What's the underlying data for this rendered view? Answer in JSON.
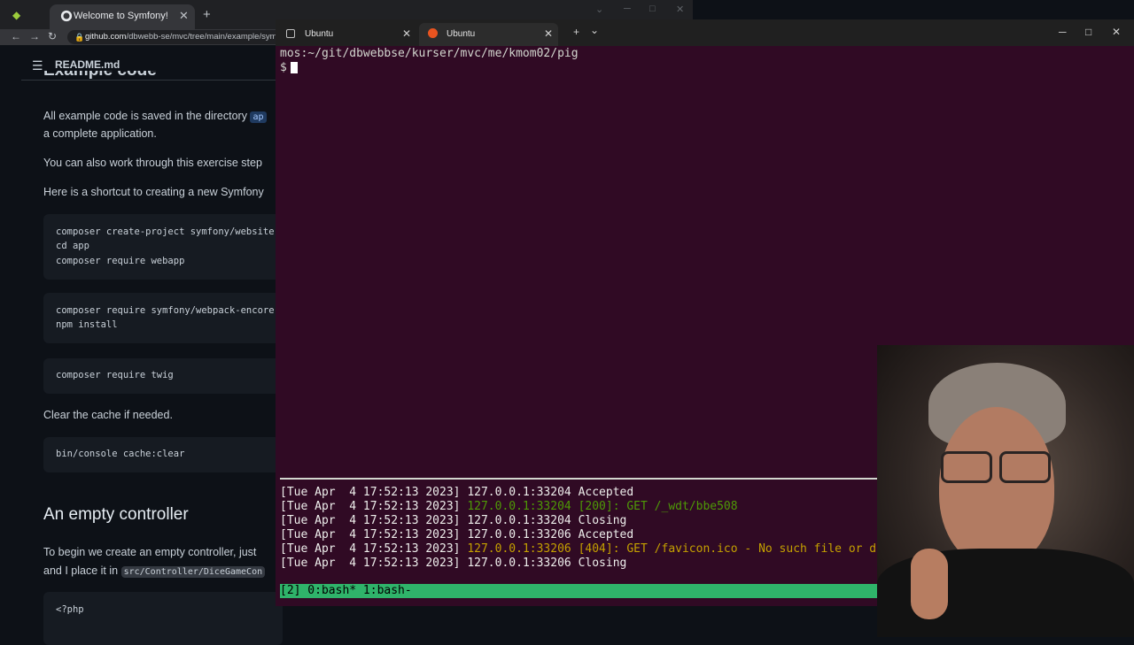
{
  "chrome": {
    "tab_title": "Welcome to Symfony!",
    "url_host": "github.com",
    "url_path": "/dbwebb-se/mvc/tree/main/example/sym"
  },
  "readme": {
    "filename": "README.md",
    "heading_top": "Example code",
    "para1_a": "All example code is saved in the directory",
    "para1_code": "ap",
    "para1_b": "a complete application.",
    "para2": "You can also work through this exercise step",
    "para3": "Here is a shortcut to creating a new Symfony",
    "code1": [
      "composer create-project symfony/website-",
      "cd app",
      "composer require webapp"
    ],
    "code2": [
      "composer require symfony/webpack-encore-",
      "npm install"
    ],
    "code3": [
      "composer require twig"
    ],
    "para4": "Clear the cache if needed.",
    "code4": [
      "bin/console cache:clear"
    ],
    "h2": "An empty controller",
    "para5": "To begin we create an empty controller, just",
    "para6_a": "and I place it in",
    "para6_code": "src/Controller/DiceGameCon",
    "code5": [
      "<?php"
    ]
  },
  "terminal": {
    "tabs": [
      {
        "label": "Ubuntu"
      },
      {
        "label": "Ubuntu"
      }
    ],
    "new_tab": "+",
    "dropdown": "⌄",
    "win_min": "─",
    "win_max": "□",
    "win_close": "✕",
    "prompt_path": "mos:~/git/dbwebbse/kurser/mvc/me/kmom02/pig",
    "prompt_symbol": "$",
    "log": [
      {
        "date": "[Tue Apr  4 17:52:13 2023]",
        "addr": "127.0.0.1:33204",
        "rest": "Accepted"
      },
      {
        "date": "[Tue Apr  4 17:52:13 2023]",
        "addr": "127.0.0.1:33204",
        "status": "[200]:",
        "rest": "GET /_wdt/bbe508"
      },
      {
        "date": "[Tue Apr  4 17:52:13 2023]",
        "addr": "127.0.0.1:33204",
        "rest": "Closing"
      },
      {
        "date": "[Tue Apr  4 17:52:13 2023]",
        "addr": "127.0.0.1:33206",
        "rest": "Accepted"
      },
      {
        "date": "[Tue Apr  4 17:52:13 2023]",
        "addr": "127.0.0.1:33206",
        "status": "[404]:",
        "rest": "GET /favicon.ico - No such file or direct"
      },
      {
        "date": "[Tue Apr  4 17:52:13 2023]",
        "addr": "127.0.0.1:33206",
        "rest": "Closing"
      }
    ],
    "tmux_status": "[2] 0:bash* 1:bash-"
  },
  "colors": {
    "terminal_bg": "#300a24",
    "tmux_green": "#2fb36a",
    "ubuntu_orange": "#e95420"
  }
}
